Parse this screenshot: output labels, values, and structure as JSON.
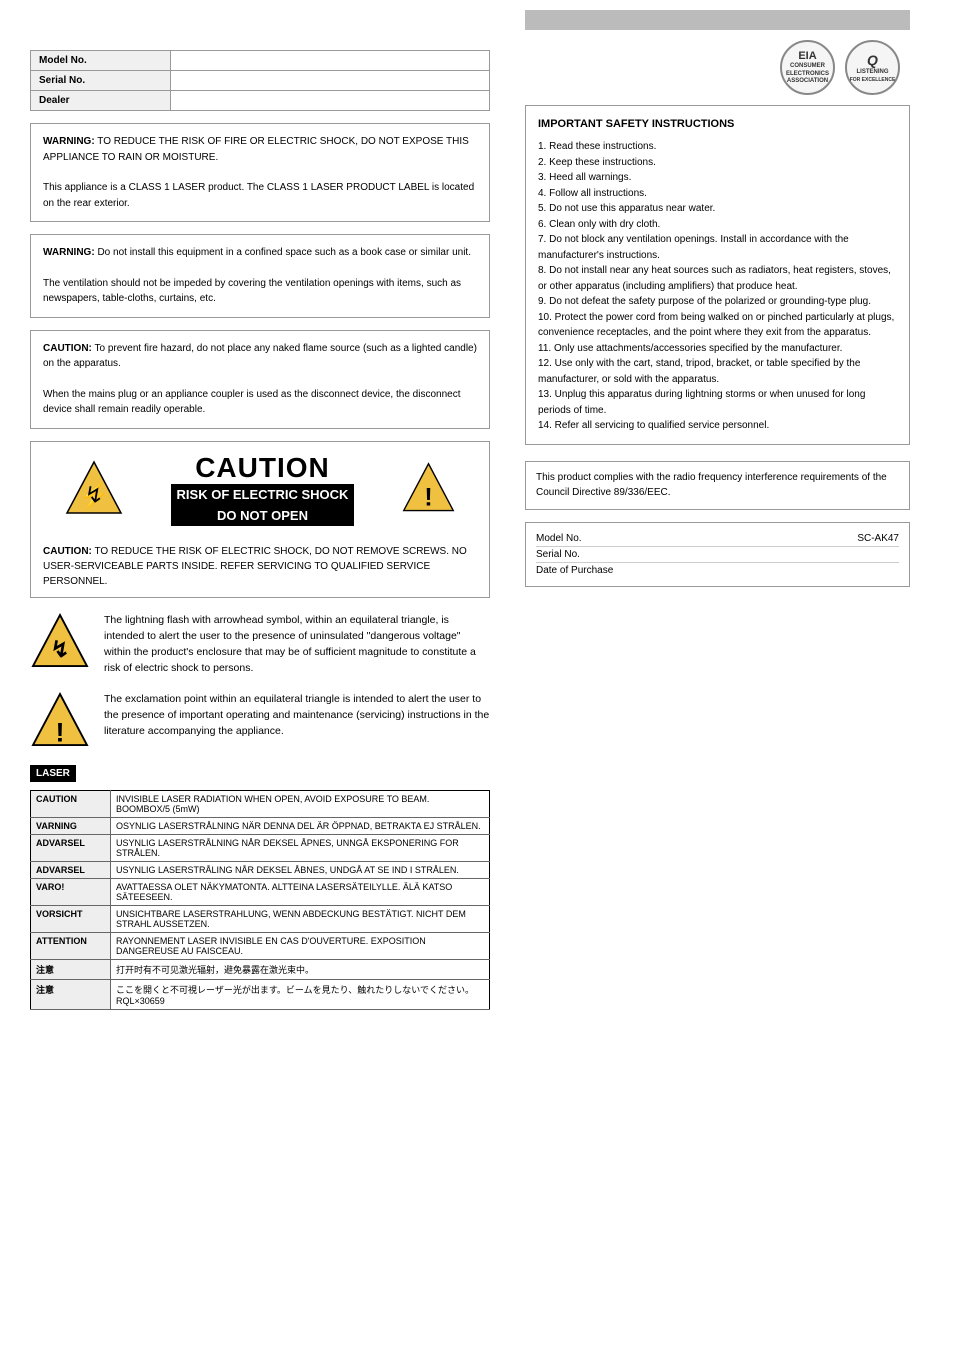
{
  "page": {
    "topbar": {
      "gray_label": ""
    },
    "logos": {
      "eia_label": "EIA",
      "eia_sub": "ASSOCIATION",
      "ql_label": "Q\nLISTENING"
    },
    "info_table": {
      "rows": [
        {
          "key": "Model No.",
          "value": ""
        },
        {
          "key": "Serial No.",
          "value": ""
        },
        {
          "key": "Dealer",
          "value": ""
        }
      ]
    },
    "warning_box_1": {
      "text": "WARNING: TO REDUCE THE RISK OF FIRE OR ELECTRIC SHOCK, DO NOT EXPOSE THIS APPLIANCE TO RAIN OR MOISTURE.\n\nThis appliance is a CLASS 1 LASER product. The CLASS 1 LASER PRODUCT LABEL is located on the rear exterior."
    },
    "warning_box_2": {
      "text": "WARNING: Do not install this equipment in a confined space such as a book case or similar unit.\n\nThe ventilation should not be impeded by covering the ventilation openings with items, such as newspapers, table-cloths, curtains, etc."
    },
    "warning_box_3": {
      "text": "CAUTION: To prevent fire hazard, do not place any naked flame source (such as a lighted candle) on the apparatus.\n\nWhen the mains plug or an appliance coupler is used as the disconnect device, the disconnect device shall remain readily operable."
    },
    "caution_box": {
      "title": "CAUTION",
      "risk_line1": "RISK OF ELECTRIC SHOCK",
      "risk_line2": "DO NOT OPEN",
      "caution_label": "CAUTION:",
      "caution_body": "TO REDUCE THE RISK OF ELECTRIC SHOCK, DO NOT REMOVE SCREWS. NO USER-SERVICEABLE PARTS INSIDE. REFER SERVICING TO QUALIFIED SERVICE PERSONNEL."
    },
    "lightning_symbol": {
      "text": "The lightning flash with arrowhead symbol, within an equilateral triangle, is intended to alert the user to the presence of uninsulated \"dangerous voltage\" within the product's enclosure that may be of sufficient magnitude to constitute a risk of electric shock to persons."
    },
    "exclaim_symbol": {
      "text": "The exclamation point within an equilateral triangle is intended to alert the user to the presence of important operating and maintenance (servicing) instructions in the literature accompanying the appliance."
    },
    "laser_table": {
      "header": "LASER",
      "rows": [
        {
          "key": "CAUTION",
          "value": "INVISIBLE LASER RADIATION WHEN OPEN, AVOID EXPOSURE TO BEAM.    BOOMBOX/5 (5mW)"
        },
        {
          "key": "VARNING",
          "value": "OSYNLIG LASERSTRÅLNING NÄR DENNA DEL ÄR ÖPPNAD, BETRAKTA EJ STRÅLEN."
        },
        {
          "key": "ADVARSEL",
          "value": "USYNLIG LASERSTRÅLNING NÅR DEKSEL ÅPNES, UNNGÅ EKSPONERING FOR STRÅLEN."
        },
        {
          "key": "ADVARSEL",
          "value": "USYNLIG LASERSTRÅLING NÅR DEKSEL ÅBN ES, UNDGÅ AT SE IND I STRÅLEN."
        },
        {
          "key": "VARO!",
          "value": "AVATTAESSA OLET NÄKYMATONTA. ALTTEINA LASERSÄTEILYLLE. ÄLÄ KATSO SÄTEESEEN."
        },
        {
          "key": "VORSICHT",
          "value": "UNSICHTBARE LASERSTRAHLUNG, WENN ABDECKUNG BESTÄTIGT. NICHT DEM STRAHL AUSSETZEN."
        },
        {
          "key": "ATTENTION",
          "value": "RAYONNEMENT LASER INVISIBLE EN CAS D'OUVERTURE. EXPOSITION DANGEREUSE AU FAISCEAU."
        },
        {
          "key": "注意",
          "value": "打开时有不可见激光辐射，避免暴露在激光束中。"
        },
        {
          "key": "注意",
          "value": "ここを開くと不可視レーザー光が出ます。ビームを見たり、触れたりしないでください。　RQL×30659"
        }
      ]
    },
    "right_col": {
      "box1": {
        "text": "IMPORTANT SAFETY INSTRUCTIONS\n\n1. Read these instructions.\n2. Keep these instructions.\n3. Heed all warnings.\n4. Follow all instructions.\n5. Do not use this apparatus near water.\n6. Clean only with dry cloth.\n7. Do not block any ventilation openings. Install in accordance with the manufacturer's instructions.\n8. Do not install near any heat sources such as radiators, heat registers, stoves, or other apparatus (including amplifiers) that produce heat.\n9. Do not defeat the safety purpose of the polarized or grounding-type plug.\n10. Protect the power cord from being walked on or pinched particularly at plugs, convenience receptacles, and the point where they exit from the apparatus.\n11. Only use attachments/accessories specified by the manufacturer.\n12. Use only with the cart, stand, tripod, bracket, or table specified by the manufacturer, or sold with the apparatus.\n13. Unplug this apparatus during lightning storms or when unused for long periods of time.\n14. Refer all servicing to qualified service personnel."
      },
      "box2": {
        "text": "This product complies with the radio frequency interference requirements of the Council Directive 89/336/EEC."
      },
      "box3": {
        "lines": [
          {
            "label": "Model No.",
            "value": "SC-AK47"
          },
          {
            "label": "Serial No.",
            "value": ""
          },
          {
            "label": "Date of Purchase",
            "value": ""
          }
        ]
      }
    }
  }
}
